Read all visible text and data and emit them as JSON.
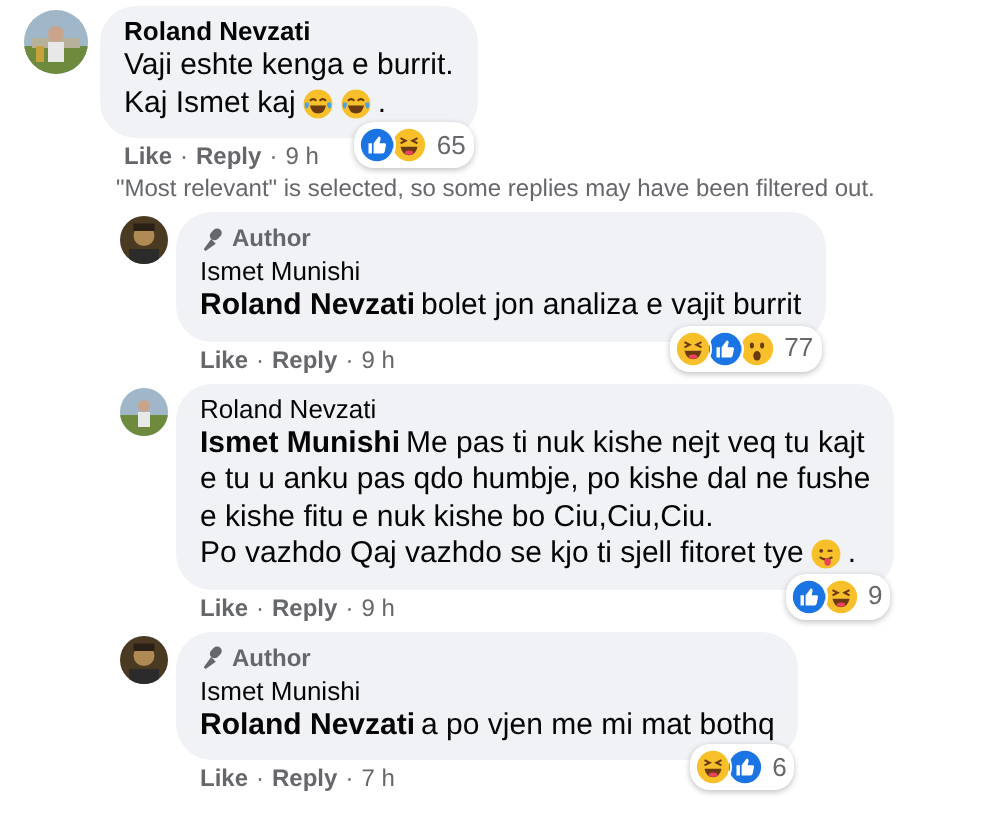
{
  "comments": [
    {
      "author": "Roland Nevzati",
      "lines": [
        [
          {
            "kind": "text",
            "text": "Vaji eshte kenga e burrit."
          }
        ],
        [
          {
            "kind": "text",
            "text": "Kaj Ismet kaj"
          },
          {
            "kind": "joy"
          },
          {
            "kind": "joy"
          },
          {
            "kind": "text",
            "text": "."
          }
        ]
      ],
      "reactions": [
        {
          "kind": "like"
        },
        {
          "kind": "haha"
        }
      ],
      "reaction_count": "65",
      "actions": [
        "Like",
        "·",
        "Reply",
        "·",
        "9 h"
      ],
      "notice": "\"Most relevant\" is selected, so some replies may have been filtered out.",
      "replies": [
        {
          "author": "Ismet Munishi",
          "author_badge": "Author",
          "lines": [
            [
              {
                "kind": "mention",
                "text": "Roland Nevzati"
              },
              {
                "kind": "text",
                "text": "bolet jon analiza e vajit burrit"
              }
            ]
          ],
          "reactions": [
            {
              "kind": "haha"
            },
            {
              "kind": "like"
            },
            {
              "kind": "wow"
            }
          ],
          "reaction_count": "77",
          "actions": [
            "Like",
            "·",
            "Reply",
            "·",
            "9 h"
          ]
        },
        {
          "author": "Roland Nevzati",
          "lines": [
            [
              {
                "kind": "mention",
                "text": "Ismet Munishi"
              },
              {
                "kind": "text",
                "text": "Me pas ti nuk kishe nejt veq tu kajt"
              }
            ],
            [
              {
                "kind": "text",
                "text": "e tu u anku pas qdo humbje, po kishe dal ne fushe"
              }
            ],
            [
              {
                "kind": "text",
                "text": "e kishe fitu e nuk kishe bo Ciu,Ciu,Ciu."
              }
            ],
            [
              {
                "kind": "text",
                "text": "Po vazhdo Qaj vazhdo se kjo ti sjell fitoret tye"
              },
              {
                "kind": "tongue"
              },
              {
                "kind": "text",
                "text": "."
              }
            ]
          ],
          "reactions": [
            {
              "kind": "like"
            },
            {
              "kind": "haha"
            }
          ],
          "reaction_count": "9",
          "actions": [
            "Like",
            "·",
            "Reply",
            "·",
            "9 h"
          ]
        },
        {
          "author": "Ismet Munishi",
          "author_badge": "Author",
          "lines": [
            [
              {
                "kind": "mention",
                "text": "Roland Nevzati"
              },
              {
                "kind": "text",
                "text": "a po vjen me mi mat bothq"
              }
            ]
          ],
          "reactions": [
            {
              "kind": "haha"
            },
            {
              "kind": "like"
            }
          ],
          "reaction_count": "6",
          "actions": [
            "Like",
            "·",
            "Reply",
            "·",
            "7 h"
          ]
        }
      ]
    }
  ]
}
